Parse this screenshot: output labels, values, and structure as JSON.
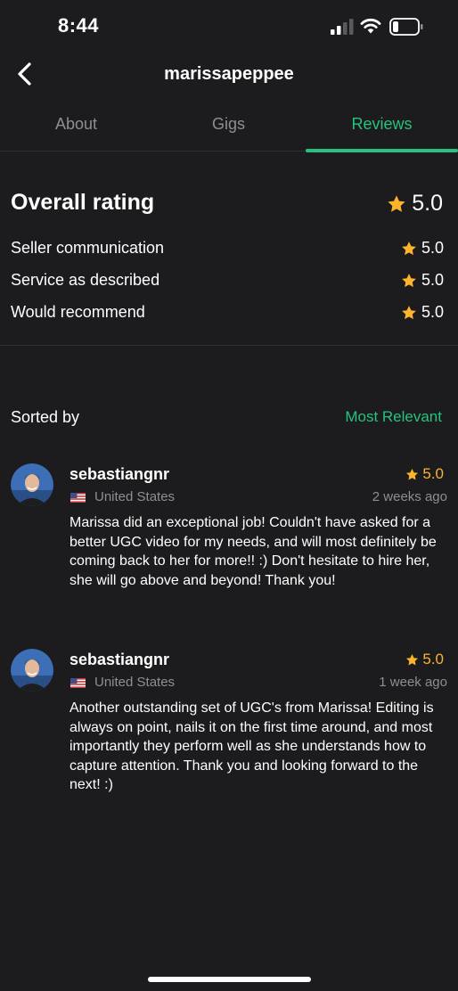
{
  "status_bar": {
    "time": "8:44",
    "signal_icon": "cellular-signal-icon",
    "wifi_icon": "wifi-icon",
    "battery_icon": "battery-low-icon"
  },
  "header": {
    "back_icon": "chevron-left-icon",
    "title": "marissapeppee"
  },
  "tabs": [
    {
      "label": "About",
      "active": false
    },
    {
      "label": "Gigs",
      "active": false
    },
    {
      "label": "Reviews",
      "active": true
    }
  ],
  "ratings": {
    "overall_label": "Overall rating",
    "overall_value": "5.0",
    "breakdown": [
      {
        "label": "Seller communication",
        "value": "5.0"
      },
      {
        "label": "Service as described",
        "value": "5.0"
      },
      {
        "label": "Would recommend",
        "value": "5.0"
      }
    ]
  },
  "sort": {
    "label": "Sorted by",
    "value": "Most Relevant"
  },
  "reviews": [
    {
      "name": "sebastiangnr",
      "rating": "5.0",
      "country": "United States",
      "date": "2 weeks ago",
      "text": "Marissa did an exceptional job! Couldn't have asked for a better UGC video for my needs, and will most definitely be coming back to her for more!! :) Don't hesitate to hire her, she will go above and beyond! Thank you!"
    },
    {
      "name": "sebastiangnr",
      "rating": "5.0",
      "country": "United States",
      "date": "1 week ago",
      "text": "Another outstanding set of UGC's from Marissa! Editing is always on point, nails it on the first time around, and most importantly they perform well as she understands how to capture attention. Thank you and looking forward to the next! :)"
    }
  ],
  "colors": {
    "background": "#1c1c1e",
    "accent": "#29c17f",
    "star": "#fdb32c",
    "muted": "#8e8e93"
  }
}
